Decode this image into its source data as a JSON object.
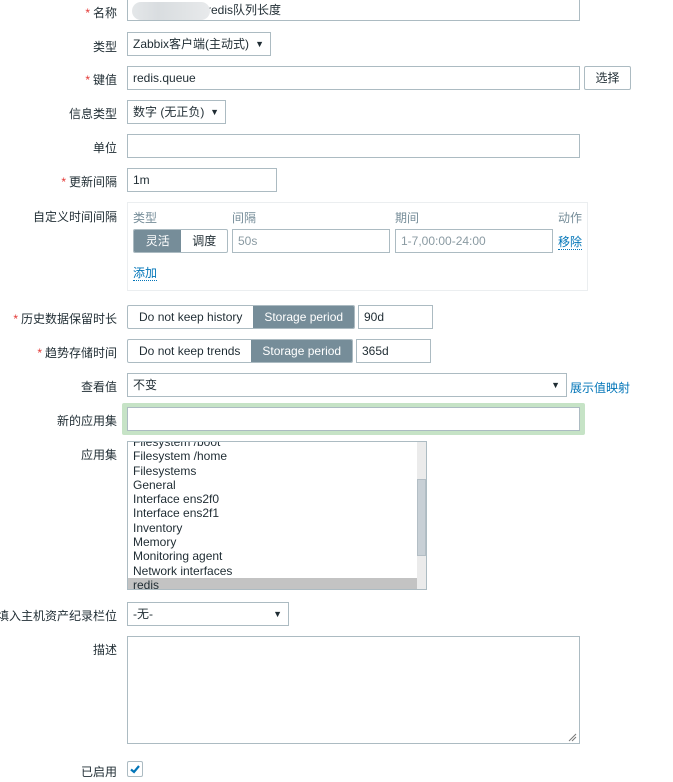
{
  "form": {
    "name": {
      "label": "名称",
      "required": true,
      "value_suffix": "redis队列长度"
    },
    "type": {
      "label": "类型",
      "value": "Zabbix客户端(主动式)"
    },
    "key": {
      "label": "键值",
      "required": true,
      "value": "redis.queue",
      "select_button": "选择"
    },
    "info_type": {
      "label": "信息类型",
      "value": "数字 (无正负)"
    },
    "units": {
      "label": "单位",
      "value": ""
    },
    "update_interval": {
      "label": "更新间隔",
      "required": true,
      "value": "1m"
    },
    "custom_intervals": {
      "label": "自定义时间间隔",
      "headers": {
        "type": "类型",
        "interval": "间隔",
        "period": "期间",
        "action": "动作"
      },
      "rows": [
        {
          "type_options": [
            "灵活",
            "调度"
          ],
          "type_selected": "灵活",
          "interval": "50s",
          "period": "1-7,00:00-24:00",
          "remove": "移除"
        }
      ],
      "add": "添加"
    },
    "history": {
      "label": "历史数据保留时长",
      "required": true,
      "options": [
        "Do not keep history",
        "Storage period"
      ],
      "selected": "Storage period",
      "value": "90d"
    },
    "trends": {
      "label": "趋势存储时间",
      "required": true,
      "options": [
        "Do not keep trends",
        "Storage period"
      ],
      "selected": "Storage period",
      "value": "365d"
    },
    "show_value": {
      "label": "查看值",
      "value": "不变",
      "link": "展示值映射"
    },
    "new_application": {
      "label": "新的应用集",
      "value": ""
    },
    "applications": {
      "label": "应用集",
      "items": [
        "Filesystem /boot",
        "Filesystem /home",
        "Filesystems",
        "General",
        "Interface ens2f0",
        "Interface ens2f1",
        "Inventory",
        "Memory",
        "Monitoring agent",
        "Network interfaces",
        "redis"
      ],
      "selected": "redis"
    },
    "inventory_field": {
      "label": "填入主机资产纪录栏位",
      "value": "-无-"
    },
    "description": {
      "label": "描述",
      "value": ""
    },
    "enabled": {
      "label": "已启用",
      "checked": true
    }
  }
}
